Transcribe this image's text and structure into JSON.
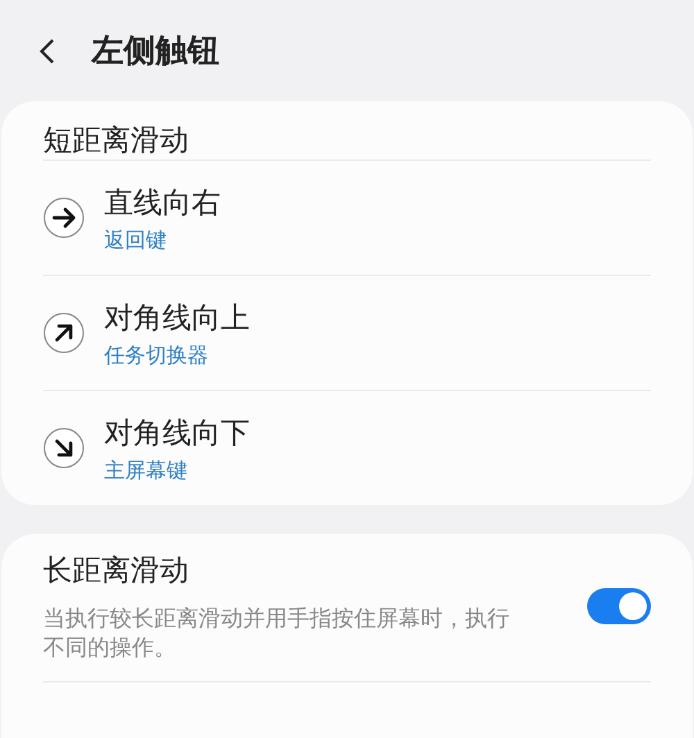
{
  "header": {
    "title": "左侧触钮"
  },
  "short_swipe": {
    "title": "短距离滑动",
    "actions": [
      {
        "gesture": "直线向右",
        "action": "返回键",
        "kind": "right"
      },
      {
        "gesture": "对角线向上",
        "action": "任务切换器",
        "kind": "up-right"
      },
      {
        "gesture": "对角线向下",
        "action": "主屏幕键",
        "kind": "down-right"
      }
    ]
  },
  "long_swipe": {
    "title": "长距离滑动",
    "description": "当执行较长距离滑动并用手指按住屏幕时，执行不同的操作。",
    "on": true
  }
}
